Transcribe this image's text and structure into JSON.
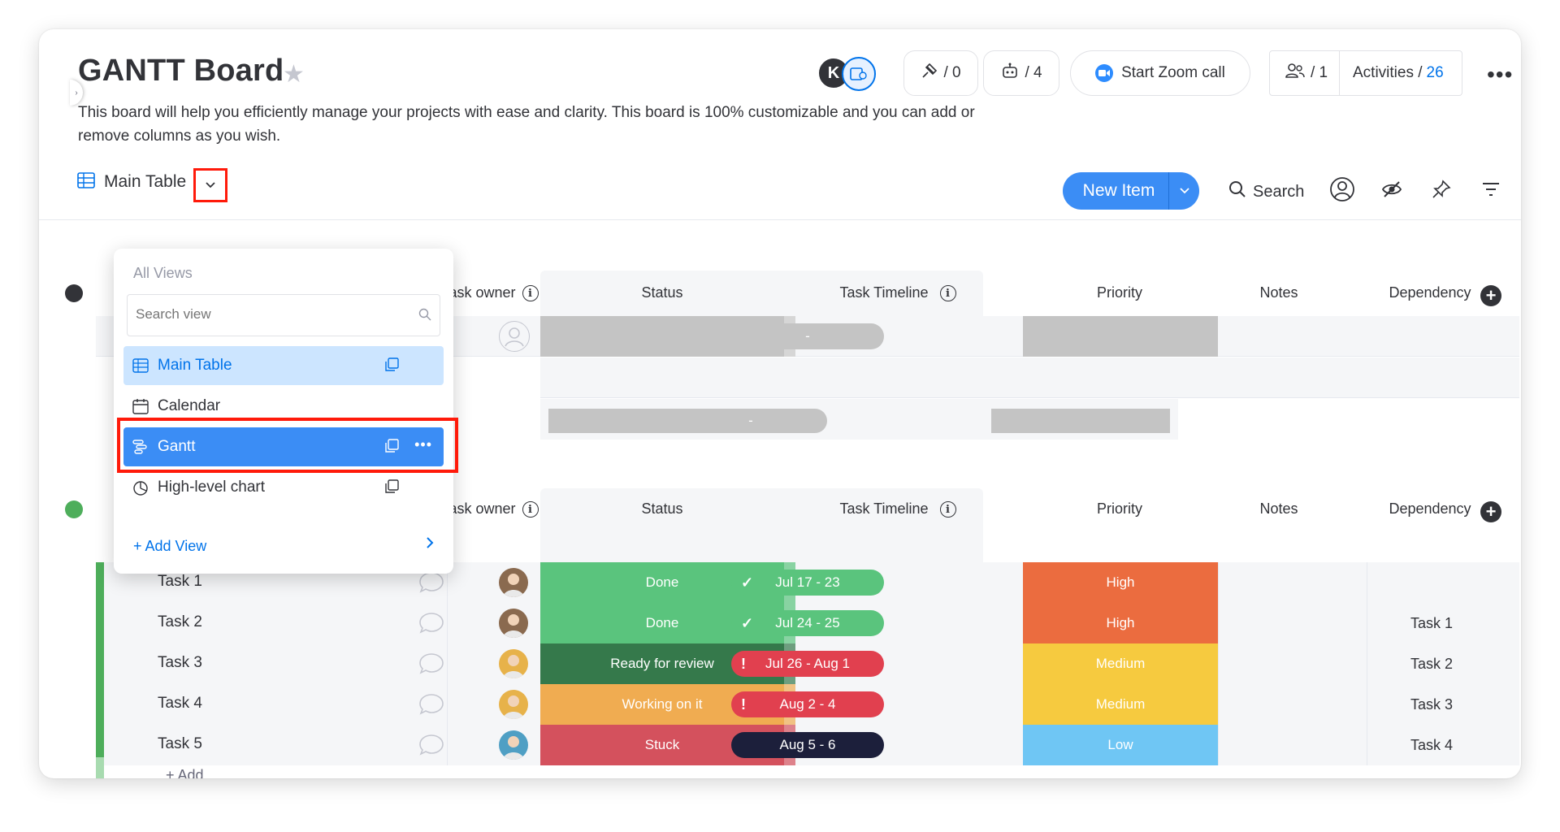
{
  "board": {
    "title": "GANTT Board",
    "description": "This board will help you efficiently manage your projects with ease and clarity. This board is 100% customizable and you can add or remove columns as you wish."
  },
  "header": {
    "avatar_initial": "K",
    "invite_count": "/ 0",
    "automations_count": "/ 4",
    "zoom_label": "Start Zoom call",
    "members_count": "/ 1",
    "activities_label": "Activities /",
    "activities_count": "26"
  },
  "view": {
    "current": "Main Table"
  },
  "toolbar": {
    "new_item_label": "New Item",
    "search_label": "Search"
  },
  "dropdown": {
    "caption": "All Views",
    "search_placeholder": "Search view",
    "items": [
      {
        "label": "Main Table",
        "icon": "table-icon"
      },
      {
        "label": "Calendar",
        "icon": "calendar-icon"
      },
      {
        "label": "Gantt",
        "icon": "gantt-icon"
      },
      {
        "label": "High-level chart",
        "icon": "chart-icon"
      }
    ],
    "add_view_label": "+ Add View"
  },
  "columns": {
    "task_owner": "Task owner",
    "status": "Status",
    "task_timeline": "Task Timeline",
    "priority": "Priority",
    "notes": "Notes",
    "dependency": "Dependency"
  },
  "group1": {
    "timeline_placeholder_1": "-",
    "timeline_placeholder_2": "-"
  },
  "colors": {
    "done": "#5ac47d",
    "ready": "#35794b",
    "working": "#f0ac51",
    "stuck": "#d4515d",
    "high": "#eb6c3f",
    "medium": "#f6ca3f",
    "low": "#6fc6f4",
    "timeline_ok": "#5ac47d",
    "timeline_late": "#e1404f",
    "timeline_dark": "#1c1f3b",
    "accent": "#3b8df5"
  },
  "tasks": [
    {
      "name": "Task 1",
      "status": "Done",
      "timeline": "Jul 17 - 23",
      "timeline_state": "check",
      "priority": "High",
      "dependency": ""
    },
    {
      "name": "Task 2",
      "status": "Done",
      "timeline": "Jul 24 - 25",
      "timeline_state": "check",
      "priority": "High",
      "dependency": "Task 1"
    },
    {
      "name": "Task 3",
      "status": "Ready for review",
      "timeline": "Jul 26 - Aug 1",
      "timeline_state": "alert",
      "priority": "Medium",
      "dependency": "Task 2"
    },
    {
      "name": "Task 4",
      "status": "Working on it",
      "timeline": "Aug 2 - 4",
      "timeline_state": "alert",
      "priority": "Medium",
      "dependency": "Task 3"
    },
    {
      "name": "Task 5",
      "status": "Stuck",
      "timeline": "Aug 5 - 6",
      "timeline_state": "none",
      "priority": "Low",
      "dependency": "Task 4"
    }
  ],
  "add_item_label": "+ Add"
}
